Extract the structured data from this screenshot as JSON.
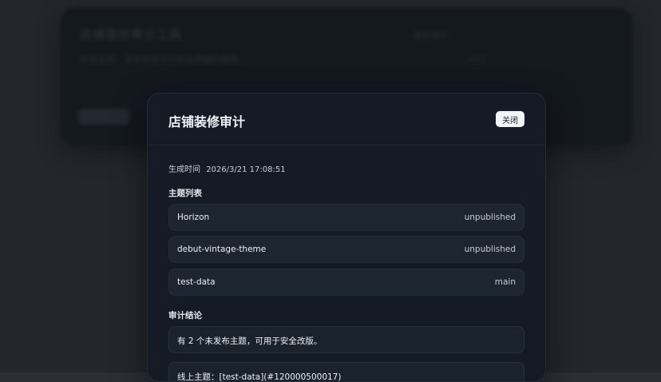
{
  "background": {
    "title": "店铺装修审计工具",
    "subtitle": "检查主题、发布状态与可安全改版的模板",
    "right_text": "最近审计",
    "right_text2": "3/21"
  },
  "modal": {
    "title": "店铺装修审计",
    "close_label": "关闭",
    "generated_label": "生成时间",
    "generated_time": "2026/3/21 17:08:51",
    "themes_heading": "主题列表",
    "themes": [
      {
        "name": "Horizon",
        "status": "unpublished"
      },
      {
        "name": "debut-vintage-theme",
        "status": "unpublished"
      },
      {
        "name": "test-data",
        "status": "main"
      }
    ],
    "conclusion_heading": "审计结论",
    "conclusions": [
      "有 2 个未发布主题，可用于安全改版。",
      "线上主题：[test-data](#120000500017)"
    ]
  },
  "colors": {
    "page_bg": "#2b2e35",
    "modal_bg": "#141b24",
    "row_bg": "#1d2530",
    "button_bg": "#f2f4f7"
  }
}
